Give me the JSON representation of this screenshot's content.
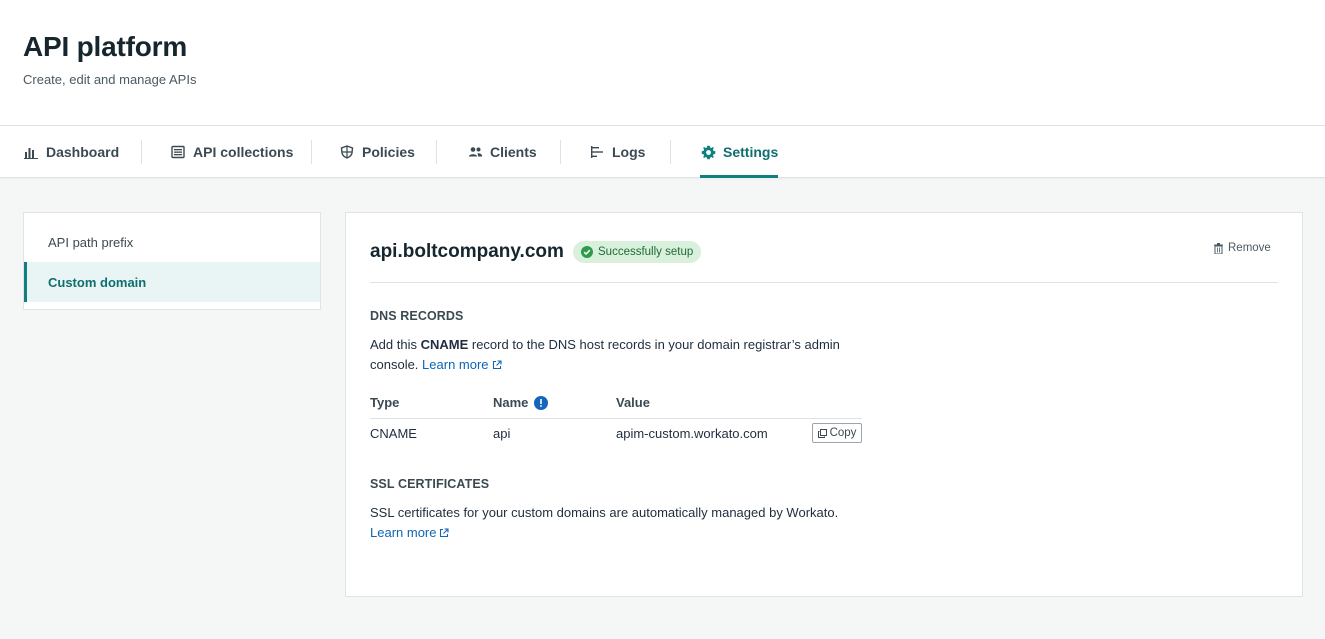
{
  "header": {
    "title": "API platform",
    "subtitle": "Create, edit and manage APIs"
  },
  "tabs": [
    {
      "label": "Dashboard",
      "icon": "bar-chart-icon"
    },
    {
      "label": "API collections",
      "icon": "collection-icon"
    },
    {
      "label": "Policies",
      "icon": "shield-icon"
    },
    {
      "label": "Clients",
      "icon": "users-icon"
    },
    {
      "label": "Logs",
      "icon": "logs-icon"
    },
    {
      "label": "Settings",
      "icon": "gear-icon",
      "active": true
    }
  ],
  "sidenav": {
    "items": [
      {
        "label": "API path prefix"
      },
      {
        "label": "Custom domain",
        "active": true
      }
    ]
  },
  "domain": {
    "name": "api.boltcompany.com",
    "status": "Successfully setup",
    "remove_label": "Remove"
  },
  "dns": {
    "heading": "DNS RECORDS",
    "text_before": "Add this ",
    "text_bold": "CNAME",
    "text_after": " record to the DNS host records in your domain registrar’s admin console. ",
    "learn_more": "Learn more",
    "columns": [
      "Type",
      "Name",
      "Value"
    ],
    "row": {
      "type": "CNAME",
      "name": "api",
      "value": "apim-custom.workato.com"
    },
    "copy_label": "Copy"
  },
  "ssl": {
    "heading": "SSL CERTIFICATES",
    "text": "SSL certificates for your custom domains are automatically managed by Workato.",
    "learn_more": "Learn more"
  },
  "colors": {
    "accent": "#0f7f7f",
    "link": "#0f66b3",
    "success_bg": "#d9f0dc",
    "success_icon": "#2e9b4a",
    "info_icon": "#1565c0"
  }
}
